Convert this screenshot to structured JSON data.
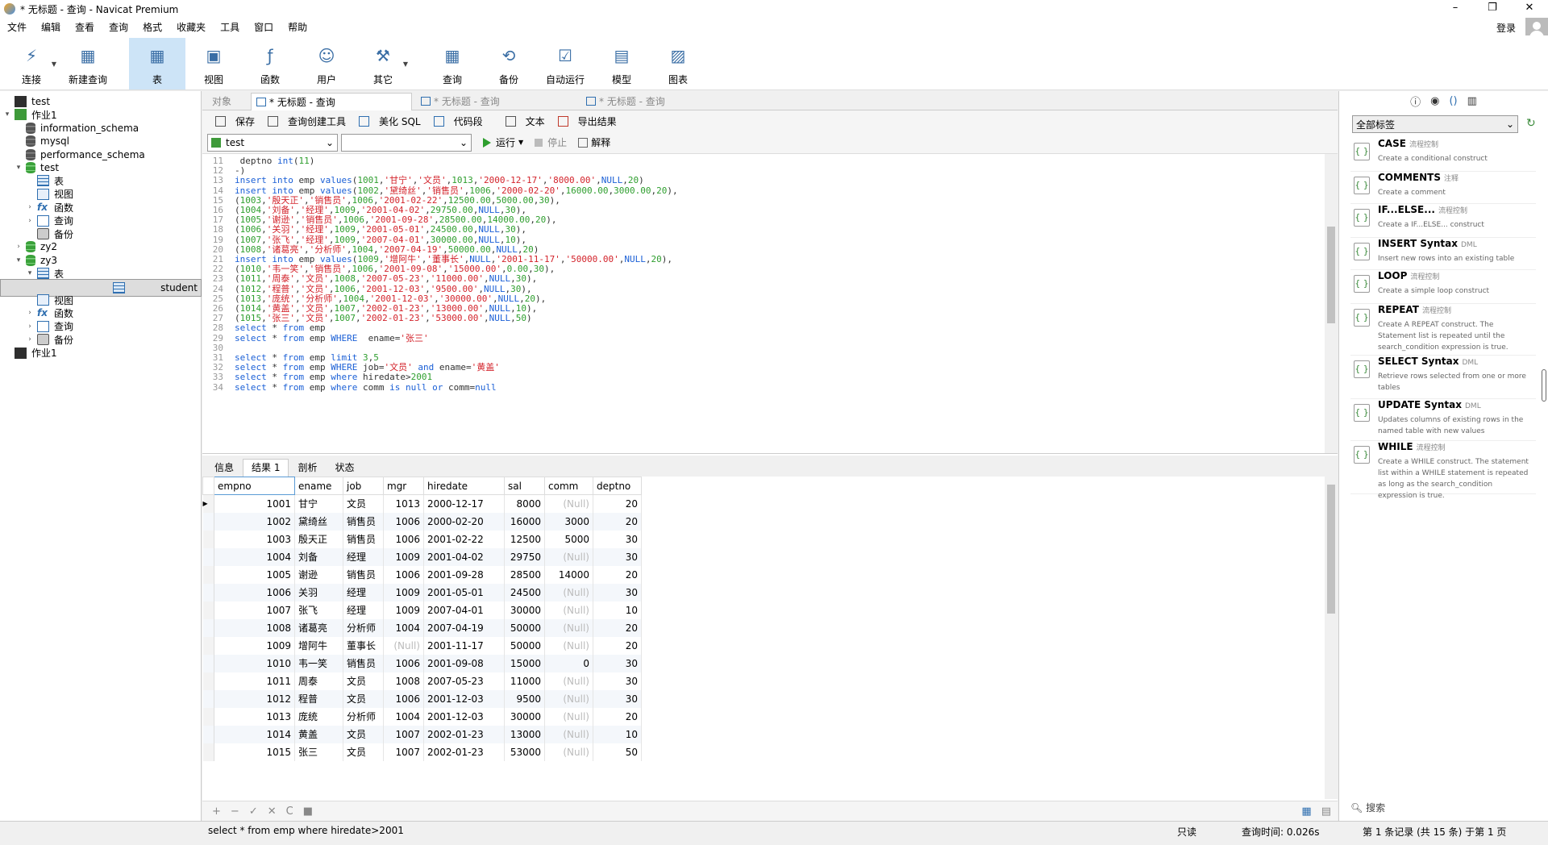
{
  "window": {
    "title": "* 无标题 - 查询 - Navicat Premium",
    "min": "–",
    "max": "❐",
    "close": "✕"
  },
  "menu": [
    "文件",
    "编辑",
    "查看",
    "查询",
    "格式",
    "收藏夹",
    "工具",
    "窗口",
    "帮助"
  ],
  "login": "登录",
  "toolbar": [
    {
      "label": "连接",
      "icon": "connect-icon"
    },
    {
      "label": "新建查询",
      "icon": "new-query-icon"
    },
    {
      "label": "表",
      "icon": "table-icon"
    },
    {
      "label": "视图",
      "icon": "view-icon"
    },
    {
      "label": "函数",
      "icon": "function-icon"
    },
    {
      "label": "用户",
      "icon": "user-icon"
    },
    {
      "label": "其它",
      "icon": "other-icon"
    },
    {
      "label": "查询",
      "icon": "query-icon"
    },
    {
      "label": "备份",
      "icon": "backup-icon"
    },
    {
      "label": "自动运行",
      "icon": "autorun-icon"
    },
    {
      "label": "模型",
      "icon": "model-icon"
    },
    {
      "label": "图表",
      "icon": "chart-icon"
    }
  ],
  "tree": [
    {
      "label": "test",
      "level": 0,
      "icon": "conn"
    },
    {
      "label": "作业1",
      "level": 0,
      "icon": "conn-g",
      "tw": "▾"
    },
    {
      "label": "information_schema",
      "level": 1,
      "icon": "db"
    },
    {
      "label": "mysql",
      "level": 1,
      "icon": "db"
    },
    {
      "label": "performance_schema",
      "level": 1,
      "icon": "db"
    },
    {
      "label": "test",
      "level": 1,
      "icon": "db-g",
      "tw": "▾"
    },
    {
      "label": "表",
      "level": 2,
      "icon": "tbl"
    },
    {
      "label": "视图",
      "level": 2,
      "icon": "view"
    },
    {
      "label": "函数",
      "level": 2,
      "icon": "fx",
      "tw": "›"
    },
    {
      "label": "查询",
      "level": 2,
      "icon": "q",
      "tw": "›"
    },
    {
      "label": "备份",
      "level": 2,
      "icon": "bk"
    },
    {
      "label": "zy2",
      "level": 1,
      "icon": "db-g",
      "tw": "›"
    },
    {
      "label": "zy3",
      "level": 1,
      "icon": "db-g",
      "tw": "▾"
    },
    {
      "label": "表",
      "level": 2,
      "icon": "tbl",
      "tw": "▾"
    },
    {
      "label": "student",
      "level": 3,
      "icon": "tbl",
      "selected": true
    },
    {
      "label": "视图",
      "level": 2,
      "icon": "view"
    },
    {
      "label": "函数",
      "level": 2,
      "icon": "fx",
      "tw": "›"
    },
    {
      "label": "查询",
      "level": 2,
      "icon": "q",
      "tw": "›"
    },
    {
      "label": "备份",
      "level": 2,
      "icon": "bk",
      "tw": "›"
    },
    {
      "label": "作业1",
      "level": 0,
      "icon": "conn"
    }
  ],
  "tabs": [
    {
      "label": "对象",
      "active": false
    },
    {
      "label": "* 无标题 - 查询",
      "active": true
    },
    {
      "label": "* 无标题 - 查询",
      "active": false
    },
    {
      "label": "* 无标题 - 查询",
      "active": false
    }
  ],
  "qtools": [
    "保存",
    "查询创建工具",
    "美化 SQL",
    "代码段",
    "文本",
    "导出结果"
  ],
  "db_select": "test",
  "schema_select": "",
  "run": "运行",
  "stop": "停止",
  "explain": "解释",
  "code": [
    {
      "n": "11",
      "t": " deptno int(11)"
    },
    {
      "n": "12",
      "t": "-)"
    },
    {
      "n": "13",
      "t": "insert into emp values(1001,'甘宁','文员',1013,'2000-12-17','8000.00',NULL,20)"
    },
    {
      "n": "14",
      "t": "insert into emp values(1002,'黛绮丝','销售员',1006,'2000-02-20',16000.00,3000.00,20),"
    },
    {
      "n": "15",
      "t": "(1003,'殷天正','销售员',1006,'2001-02-22',12500.00,5000.00,30),"
    },
    {
      "n": "16",
      "t": "(1004,'刘备','经理',1009,'2001-04-02',29750.00,NULL,30),"
    },
    {
      "n": "17",
      "t": "(1005,'谢逊','销售员',1006,'2001-09-28',28500.00,14000.00,20),"
    },
    {
      "n": "18",
      "t": "(1006,'关羽','经理',1009,'2001-05-01',24500.00,NULL,30),"
    },
    {
      "n": "19",
      "t": "(1007,'张飞','经理',1009,'2007-04-01',30000.00,NULL,10),"
    },
    {
      "n": "20",
      "t": "(1008,'诸葛亮','分析师',1004,'2007-04-19',50000.00,NULL,20)"
    },
    {
      "n": "21",
      "t": "insert into emp values(1009,'增阿牛','董事长',NULL,'2001-11-17','50000.00',NULL,20),"
    },
    {
      "n": "22",
      "t": "(1010,'韦一笑','销售员',1006,'2001-09-08','15000.00',0.00,30),"
    },
    {
      "n": "23",
      "t": "(1011,'周泰','文员',1008,'2007-05-23','11000.00',NULL,30),"
    },
    {
      "n": "24",
      "t": "(1012,'程普','文员',1006,'2001-12-03','9500.00',NULL,30),"
    },
    {
      "n": "25",
      "t": "(1013,'庞统','分析师',1004,'2001-12-03','30000.00',NULL,20),"
    },
    {
      "n": "26",
      "t": "(1014,'黄盖','文员',1007,'2002-01-23','13000.00',NULL,10),"
    },
    {
      "n": "27",
      "t": "(1015,'张三','文员',1007,'2002-01-23','53000.00',NULL,50)"
    },
    {
      "n": "28",
      "t": "select * from emp"
    },
    {
      "n": "29",
      "t": "select * from emp WHERE  ename='张三'"
    },
    {
      "n": "30",
      "t": ""
    },
    {
      "n": "31",
      "t": "select * from emp limit 3,5"
    },
    {
      "n": "32",
      "t": "select * from emp WHERE job='文员' and ename='黄盖'"
    },
    {
      "n": "33",
      "t": "select * from emp where hiredate>2001"
    },
    {
      "n": "34",
      "t": "select * from emp where comm is null or comm=null"
    }
  ],
  "result_tabs": [
    "信息",
    "结果 1",
    "剖析",
    "状态"
  ],
  "columns": [
    "empno",
    "ename",
    "job",
    "mgr",
    "hiredate",
    "sal",
    "comm",
    "deptno"
  ],
  "rows": [
    [
      "1001",
      "甘宁",
      "文员",
      "1013",
      "2000-12-17",
      "8000",
      "(Null)",
      "20"
    ],
    [
      "1002",
      "黛绮丝",
      "销售员",
      "1006",
      "2000-02-20",
      "16000",
      "3000",
      "20"
    ],
    [
      "1003",
      "殷天正",
      "销售员",
      "1006",
      "2001-02-22",
      "12500",
      "5000",
      "30"
    ],
    [
      "1004",
      "刘备",
      "经理",
      "1009",
      "2001-04-02",
      "29750",
      "(Null)",
      "30"
    ],
    [
      "1005",
      "谢逊",
      "销售员",
      "1006",
      "2001-09-28",
      "28500",
      "14000",
      "20"
    ],
    [
      "1006",
      "关羽",
      "经理",
      "1009",
      "2001-05-01",
      "24500",
      "(Null)",
      "30"
    ],
    [
      "1007",
      "张飞",
      "经理",
      "1009",
      "2007-04-01",
      "30000",
      "(Null)",
      "10"
    ],
    [
      "1008",
      "诸葛亮",
      "分析师",
      "1004",
      "2007-04-19",
      "50000",
      "(Null)",
      "20"
    ],
    [
      "1009",
      "增阿牛",
      "董事长",
      "(Null)",
      "2001-11-17",
      "50000",
      "(Null)",
      "20"
    ],
    [
      "1010",
      "韦一笑",
      "销售员",
      "1006",
      "2001-09-08",
      "15000",
      "0",
      "30"
    ],
    [
      "1011",
      "周泰",
      "文员",
      "1008",
      "2007-05-23",
      "11000",
      "(Null)",
      "30"
    ],
    [
      "1012",
      "程普",
      "文员",
      "1006",
      "2001-12-03",
      "9500",
      "(Null)",
      "30"
    ],
    [
      "1013",
      "庞统",
      "分析师",
      "1004",
      "2001-12-03",
      "30000",
      "(Null)",
      "20"
    ],
    [
      "1014",
      "黄盖",
      "文员",
      "1007",
      "2002-01-23",
      "13000",
      "(Null)",
      "10"
    ],
    [
      "1015",
      "张三",
      "文员",
      "1007",
      "2002-01-23",
      "53000",
      "(Null)",
      "50"
    ]
  ],
  "grid_footer": [
    "+",
    "−",
    "✓",
    "✕",
    "C",
    "■"
  ],
  "status": {
    "sql": "select * from emp where hiredate>2001",
    "readonly": "只读",
    "time": "查询时间: 0.026s",
    "records": "第 1 条记录 (共 15 条) 于第 1 页"
  },
  "snippets_select": "全部标签",
  "snippets": [
    {
      "name": "CASE",
      "tag": "流程控制",
      "desc": "Create a conditional construct"
    },
    {
      "name": "COMMENTS",
      "tag": "注释",
      "desc": "Create a comment"
    },
    {
      "name": "IF...ELSE...",
      "tag": "流程控制",
      "desc": "Create a IF...ELSE... construct"
    },
    {
      "name": "INSERT Syntax",
      "tag": "DML",
      "desc": "Insert new rows into an existing table"
    },
    {
      "name": "LOOP",
      "tag": "流程控制",
      "desc": "Create a simple loop construct"
    },
    {
      "name": "REPEAT",
      "tag": "流程控制",
      "desc": "Create A REPEAT construct. The Statement list is repeated until the search_condition expression is true."
    },
    {
      "name": "SELECT Syntax",
      "tag": "DML",
      "desc": "Retrieve rows selected from one or more tables"
    },
    {
      "name": "UPDATE Syntax",
      "tag": "DML",
      "desc": "Updates columns of existing rows in the named table with new values"
    },
    {
      "name": "WHILE",
      "tag": "流程控制",
      "desc": "Create a WHILE construct. The statement list within a WHILE statement is repeated as long as the search_condition expression is true."
    }
  ],
  "search": "搜索"
}
